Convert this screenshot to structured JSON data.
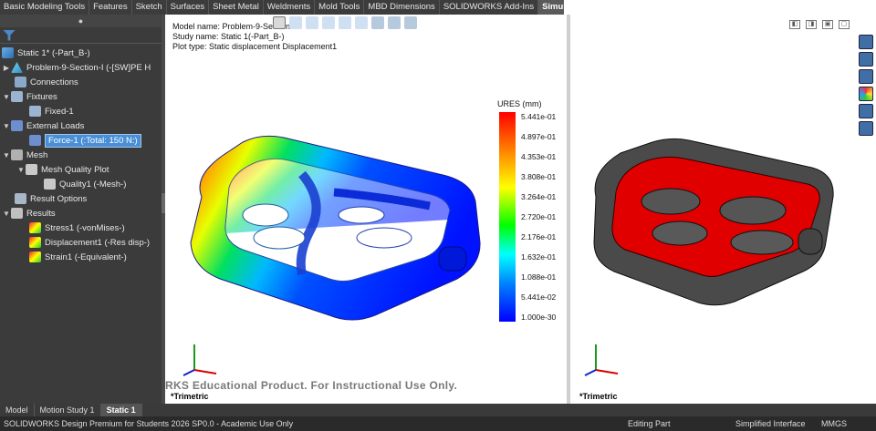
{
  "tabs": [
    "Basic Modeling Tools",
    "Features",
    "Sketch",
    "Surfaces",
    "Sheet Metal",
    "Weldments",
    "Mold Tools",
    "MBD Dimensions",
    "SOLIDWORKS Add-Ins",
    "Simulation"
  ],
  "active_tab": "Simulation",
  "tree": {
    "study": "Static 1* (-Part_B-)",
    "part": "Problem-9-Section-I (-[SW]PE H",
    "connections": "Connections",
    "fixtures": "Fixtures",
    "fixed": "Fixed-1",
    "external_loads": "External Loads",
    "force": "Force-1 (:Total: 150 N:)",
    "mesh": "Mesh",
    "mesh_quality_plot": "Mesh Quality Plot",
    "quality": "Quality1 (-Mesh-)",
    "result_options": "Result Options",
    "results": "Results",
    "stress": "Stress1 (-vonMises-)",
    "displacement": "Displacement1 (-Res disp-)",
    "strain": "Strain1 (-Equivalent-)"
  },
  "viewport": {
    "model_name": "Model name: Problem-9-Section",
    "study_name": "Study name: Static 1(-Part_B-)",
    "plot_type": "Plot type: Static displacement Displacement1",
    "legend_title": "URES (mm)",
    "legend_values": [
      "5.441e-01",
      "4.897e-01",
      "4.353e-01",
      "3.808e-01",
      "3.264e-01",
      "2.720e-01",
      "2.176e-01",
      "1.632e-01",
      "1.088e-01",
      "5.441e-02",
      "1.000e-30"
    ],
    "watermark": "RKS Educational Product. For Instructional Use Only.",
    "view_label": "*Trimetric"
  },
  "viewport2": {
    "view_label": "*Trimetric"
  },
  "bottom_tabs": [
    "Model",
    "Motion Study 1",
    "Static 1"
  ],
  "status": {
    "product": "SOLIDWORKS Design Premium for Students 2026 SP0.0 - Academic Use Only",
    "mode": "Editing Part",
    "interface": "Simplified Interface",
    "units": "MMGS"
  },
  "colors": {
    "panel": "#3b3b3b",
    "selection": "#4a8fd6",
    "accent_red": "#e00000"
  }
}
